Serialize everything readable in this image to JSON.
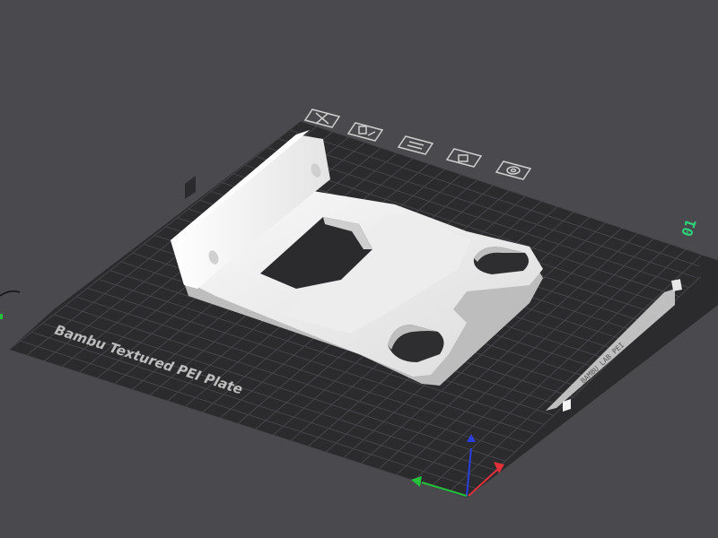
{
  "plate": {
    "name": "Bambu Textured PEI Plate",
    "number": "01",
    "label_strip_text": "BAMBU LAB PEI",
    "colors": {
      "background": "#4a4a4e",
      "plate": "#2b2b2e",
      "grid": "#47474b",
      "model": "#f1f1f1",
      "number": "#2fd37a"
    }
  },
  "plate_toolbar": {
    "icons": [
      "delete-plate-icon",
      "auto-arrange-icon",
      "orient-icon",
      "lock-plate-icon",
      "plate-settings-icon"
    ]
  },
  "axes": {
    "x_color": "#e0303a",
    "y_color": "#24c23c",
    "z_color": "#2a3fe0"
  }
}
